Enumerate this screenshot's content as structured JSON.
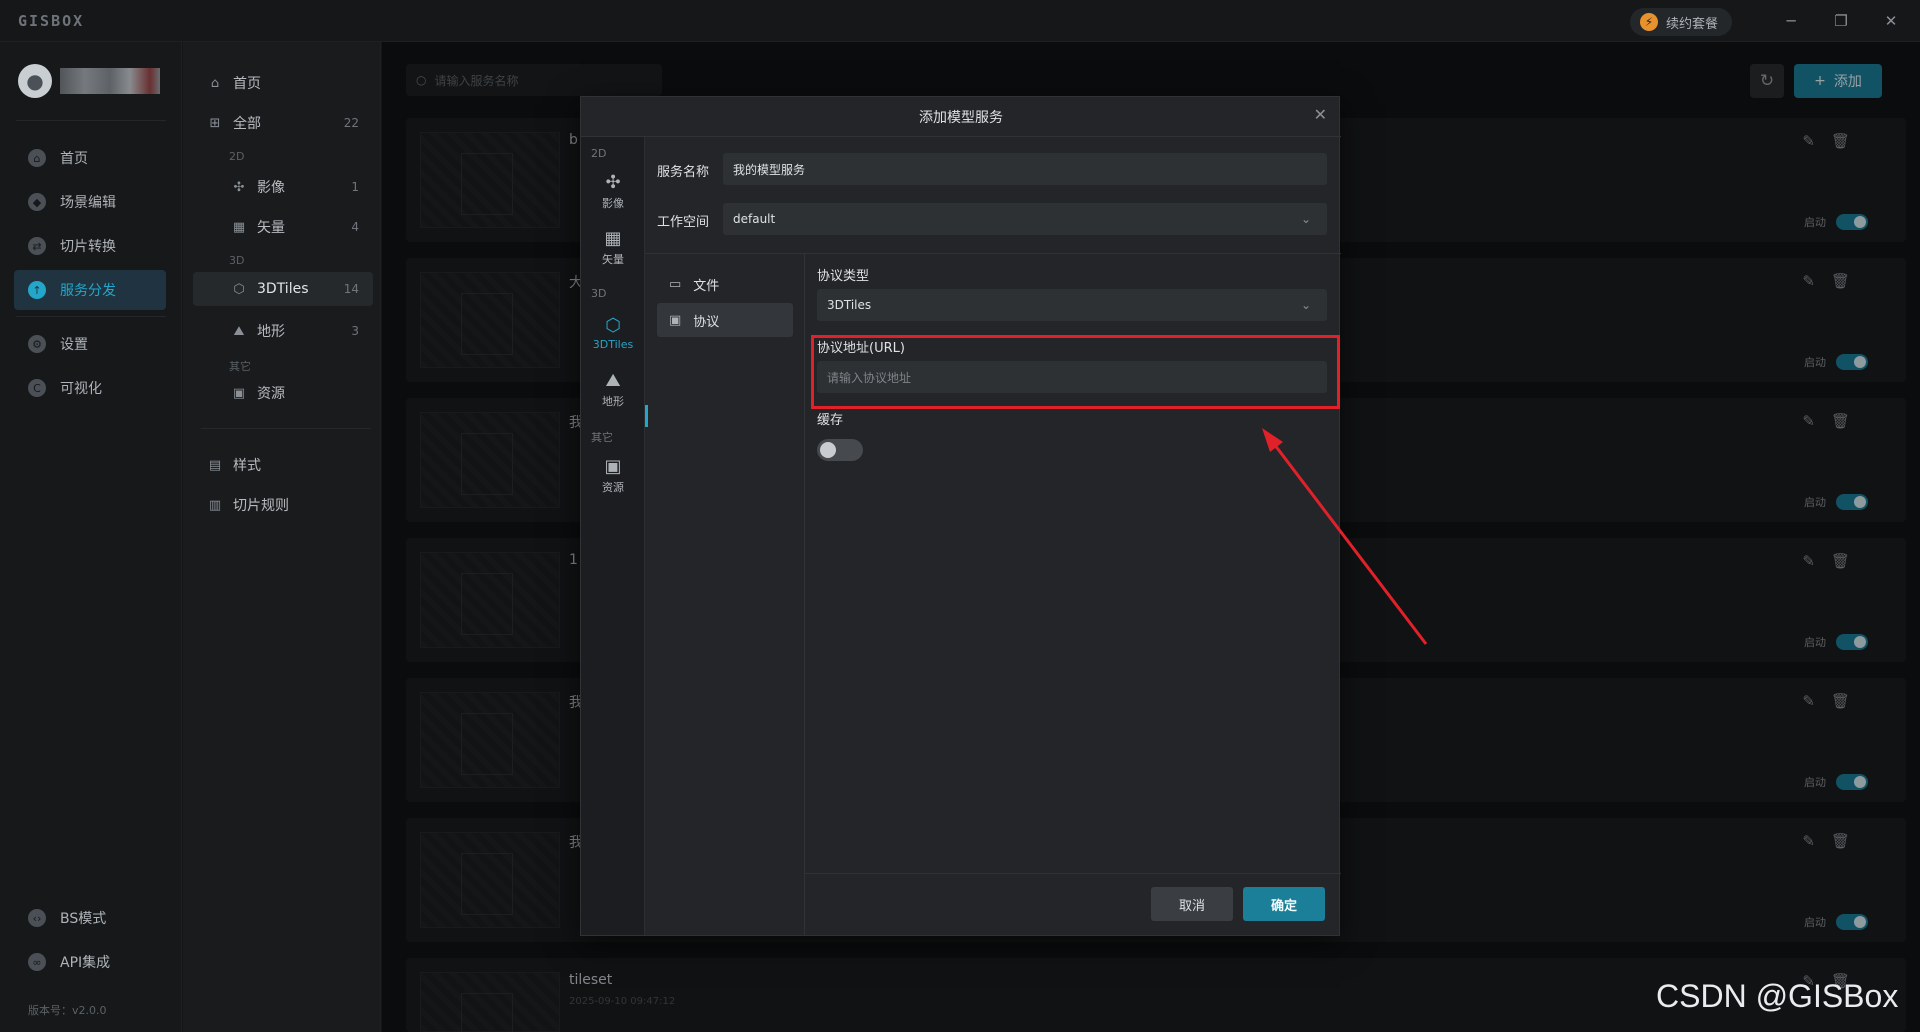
{
  "app": {
    "logo": "GISBOX",
    "renew_label": "续约套餐",
    "version": "版本号：v2.0.0"
  },
  "nav": {
    "items": [
      {
        "label": "首页",
        "icon": "home-icon"
      },
      {
        "label": "场景编辑",
        "icon": "cube-icon"
      },
      {
        "label": "切片转换",
        "icon": "convert-icon"
      },
      {
        "label": "服务分发",
        "icon": "upload-icon"
      },
      {
        "label": "设置",
        "icon": "gear-icon"
      },
      {
        "label": "可视化",
        "icon": "chart-icon"
      }
    ],
    "bottom": [
      {
        "label": "BS模式",
        "icon": "code-icon"
      },
      {
        "label": "API集成",
        "icon": "link-icon"
      }
    ],
    "active": "服务分发"
  },
  "categories": {
    "home": {
      "label": "首页"
    },
    "all": {
      "label": "全部",
      "count": "22"
    },
    "group_2d": "2D",
    "image": {
      "label": "影像",
      "count": "1"
    },
    "vector": {
      "label": "矢量",
      "count": "4"
    },
    "group_3d": "3D",
    "tiles": {
      "label": "3DTiles",
      "count": "14"
    },
    "terrain": {
      "label": "地形",
      "count": "3"
    },
    "group_other": "其它",
    "resource": {
      "label": "资源"
    },
    "style": {
      "label": "样式"
    },
    "rules": {
      "label": "切片规则"
    }
  },
  "main": {
    "search_placeholder": "请输入服务名称",
    "add_label": "添加",
    "cards": [
      {
        "title": "b",
        "toggle": "启动"
      },
      {
        "title": "大",
        "toggle": "启动"
      },
      {
        "title": "我",
        "toggle": "启动"
      },
      {
        "title": "1",
        "toggle": "启动"
      },
      {
        "title": "我",
        "toggle": "启动"
      },
      {
        "title": "我",
        "toggle": "启动"
      },
      {
        "title": "tileset",
        "date": "2025-09-10 09:47:12",
        "toggle": ""
      }
    ]
  },
  "modal": {
    "title": "添加模型服务",
    "type_groups": {
      "g2d": "2D",
      "g3d": "3D",
      "gother": "其它"
    },
    "types": [
      {
        "label": "影像",
        "icon": "satellite-icon"
      },
      {
        "label": "矢量",
        "icon": "vector-icon"
      },
      {
        "label": "3DTiles",
        "icon": "tiles-icon"
      },
      {
        "label": "地形",
        "icon": "terrain-icon"
      },
      {
        "label": "资源",
        "icon": "resource-icon"
      }
    ],
    "service_name_label": "服务名称",
    "service_name_value": "我的模型服务",
    "workspace_label": "工作空间",
    "workspace_value": "default",
    "source_menu": [
      {
        "label": "文件",
        "icon": "folder-icon"
      },
      {
        "label": "协议",
        "icon": "protocol-icon"
      }
    ],
    "protocol_type_label": "协议类型",
    "protocol_type_value": "3DTiles",
    "url_label": "协议地址(URL)",
    "url_placeholder": "请输入协议地址",
    "cache_label": "缓存",
    "cancel_label": "取消",
    "ok_label": "确定"
  },
  "watermark": "CSDN @GISBox",
  "colors": {
    "accent": "#1b7f9a",
    "active_text": "#23a6c9",
    "highlight": "#e0212a"
  }
}
